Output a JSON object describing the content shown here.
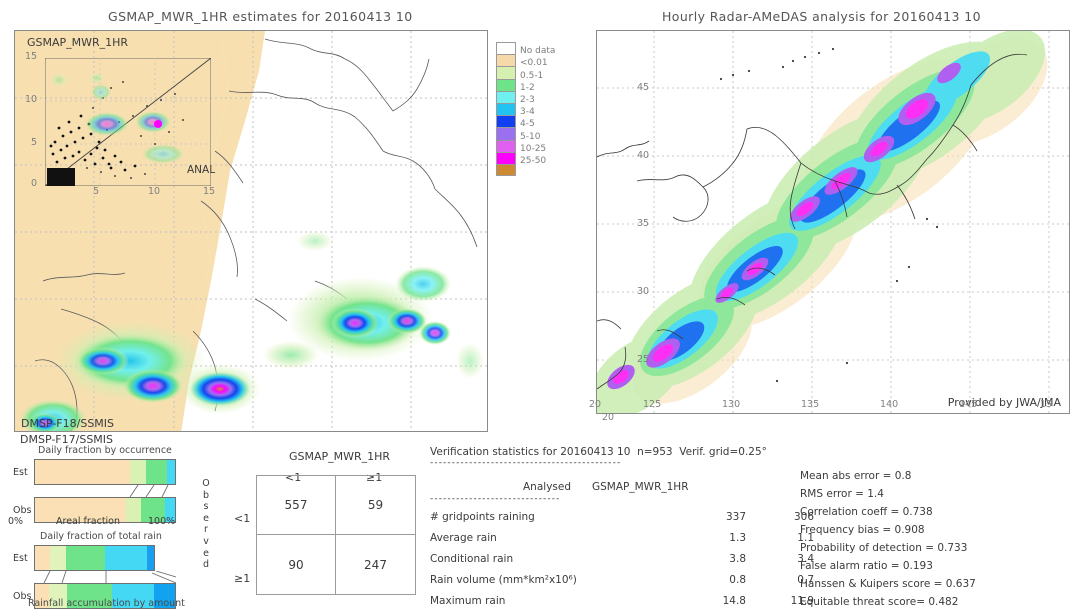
{
  "left_panel": {
    "title": "GSMAP_MWR_1HR estimates for 20160413 10",
    "inset_label": "GSMAP_MWR_1HR",
    "inset_axis_label": "ANAL",
    "inset_ticks": [
      "15",
      "10",
      "5",
      "0"
    ],
    "inset_x_ticks": [
      "0",
      "5",
      "10",
      "15"
    ],
    "sensor_inside": "DMSP-F18/SSMIS",
    "sensor_below": "DMSP-F17/SSMIS"
  },
  "right_panel": {
    "title": "Hourly Radar-AMeDAS analysis for 20160413 10",
    "credit": "Provided by JWA/JMA",
    "x_ticks": [
      "20",
      "125",
      "130",
      "135",
      "140",
      "145",
      "15"
    ],
    "y_ticks": [
      "45",
      "40",
      "35",
      "30",
      "25",
      "20"
    ],
    "corner_tick": "20"
  },
  "colorbar": {
    "labels": [
      "No data",
      "<0.01",
      "0.5-1",
      "1-2",
      "2-3",
      "3-4",
      "4-5",
      "5-10",
      "10-25",
      "25-50"
    ],
    "colors": [
      "#ffffff",
      "#f5d9a8",
      "#d6f0b0",
      "#6fe38a",
      "#6ff0f0",
      "#22c3f0",
      "#1040f0",
      "#9a70f0",
      "#e060f0",
      "#ff00ff",
      "#cc8a33"
    ]
  },
  "occurrence_chart": {
    "caption": "Daily fraction by occurrence",
    "row_labels": [
      "Est",
      "Obs"
    ],
    "x_left": "0%",
    "x_center": "Areal fraction",
    "x_right": "100%",
    "est_segments": [
      {
        "color": "#fae0b4",
        "pct": 68
      },
      {
        "color": "#d9f2b4",
        "pct": 11
      },
      {
        "color": "#6fe38a",
        "pct": 15
      },
      {
        "color": "#45d8f5",
        "pct": 6
      }
    ],
    "obs_segments": [
      {
        "color": "#fae0b4",
        "pct": 65
      },
      {
        "color": "#d9f2b4",
        "pct": 11
      },
      {
        "color": "#6fe38a",
        "pct": 17
      },
      {
        "color": "#45d8f5",
        "pct": 7
      }
    ]
  },
  "total_rain_chart": {
    "caption": "Daily fraction of total rain",
    "bottom_caption": "Rainfall accumulation by amount",
    "row_labels": [
      "Est",
      "Obs"
    ],
    "est_segments": [
      {
        "color": "#fae0b4",
        "pct": 13
      },
      {
        "color": "#dff3bb",
        "pct": 13
      },
      {
        "color": "#6fe38a",
        "pct": 33
      },
      {
        "color": "#45d8f5",
        "pct": 35
      },
      {
        "color": "#1a9ef0",
        "pct": 6
      }
    ],
    "obs_segments": [
      {
        "color": "#fae0b4",
        "pct": 10
      },
      {
        "color": "#dff3bb",
        "pct": 13
      },
      {
        "color": "#6fe38a",
        "pct": 32
      },
      {
        "color": "#45d8f5",
        "pct": 30
      },
      {
        "color": "#12a3f0",
        "pct": 15
      }
    ]
  },
  "contingency": {
    "header": "GSMAP_MWR_1HR",
    "col_headers": [
      "<1",
      "≥1"
    ],
    "row_headers": [
      "<1",
      "≥1"
    ],
    "axis_label": "Observed",
    "cells": [
      [
        "557",
        "59"
      ],
      [
        "90",
        "247"
      ]
    ]
  },
  "verification": {
    "header": "Verification statistics for 20160413 10  n=953  Verif. grid=0.25°",
    "divider": "--------------------------------------------",
    "col_analysed": "Analysed",
    "col_product": "GSMAP_MWR_1HR",
    "divider2": "------------------------------",
    "rows": [
      {
        "label": "# gridpoints raining",
        "analysed": "337",
        "product": "306"
      },
      {
        "label": "Average rain",
        "analysed": "1.3",
        "product": "1.1"
      },
      {
        "label": "Conditional rain",
        "analysed": "3.8",
        "product": "3.4"
      },
      {
        "label": "Rain volume (mm*km²x10⁶)",
        "analysed": "0.8",
        "product": "0.7"
      },
      {
        "label": "Maximum rain",
        "analysed": "14.8",
        "product": "11.9"
      }
    ]
  },
  "scores": [
    "Mean abs error = 0.8",
    "RMS error = 1.4",
    "Correlation coeff = 0.738",
    "Frequency bias = 0.908",
    "Probability of detection = 0.733",
    "False alarm ratio = 0.193",
    "Hanssen & Kuipers score = 0.637",
    "Equitable threat score= 0.482"
  ]
}
